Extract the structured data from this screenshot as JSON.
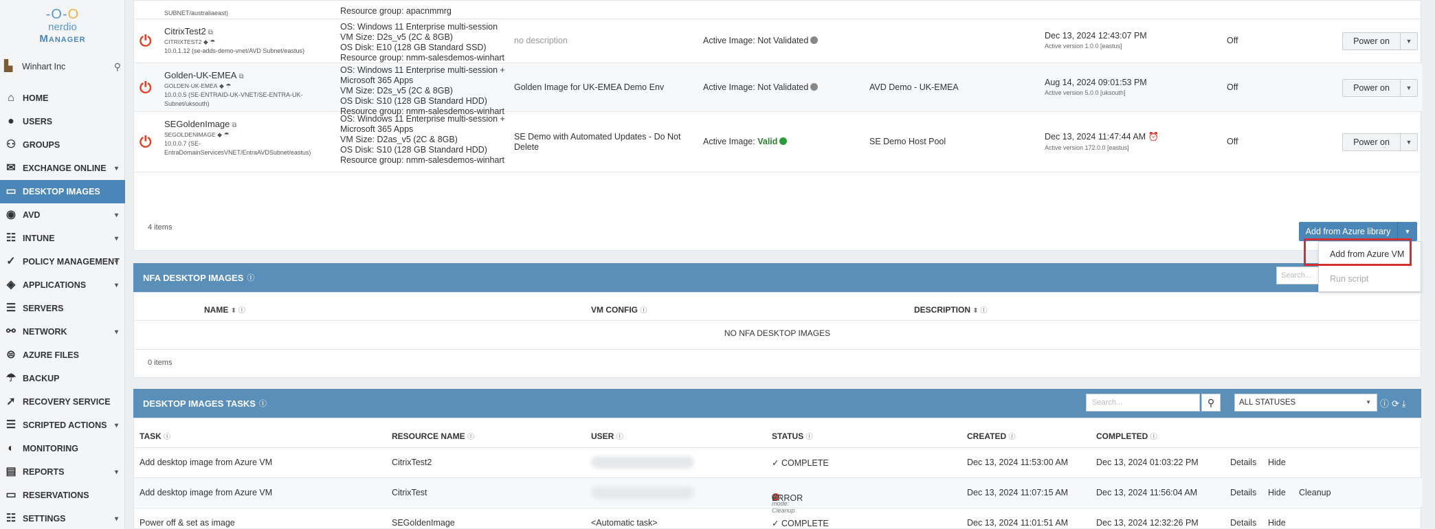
{
  "sidebar": {
    "logo_top": "nerdio",
    "logo_bottom": "Manager",
    "tenant": "Winhart Inc",
    "items": [
      {
        "label": "HOME",
        "icon": "home-icon",
        "glyph": "⌂",
        "chevron": false
      },
      {
        "label": "USERS",
        "icon": "user-icon",
        "glyph": "●",
        "chevron": false
      },
      {
        "label": "GROUPS",
        "icon": "groups-icon",
        "glyph": "⚇",
        "chevron": false
      },
      {
        "label": "EXCHANGE ONLINE",
        "icon": "mail-icon",
        "glyph": "✉",
        "chevron": true
      },
      {
        "label": "DESKTOP IMAGES",
        "icon": "desktop-icon",
        "glyph": "▭",
        "chevron": false,
        "active": true
      },
      {
        "label": "AVD",
        "icon": "avd-icon",
        "glyph": "◉",
        "chevron": true
      },
      {
        "label": "INTUNE",
        "icon": "intune-icon",
        "glyph": "☷",
        "chevron": true
      },
      {
        "label": "POLICY MANAGEMENT",
        "icon": "policy-icon",
        "glyph": "✓",
        "chevron": true
      },
      {
        "label": "APPLICATIONS",
        "icon": "apps-icon",
        "glyph": "◈",
        "chevron": true
      },
      {
        "label": "SERVERS",
        "icon": "servers-icon",
        "glyph": "☰",
        "chevron": false
      },
      {
        "label": "NETWORK",
        "icon": "network-icon",
        "glyph": "⚯",
        "chevron": true
      },
      {
        "label": "AZURE FILES",
        "icon": "files-icon",
        "glyph": "⊜",
        "chevron": false
      },
      {
        "label": "BACKUP",
        "icon": "backup-icon",
        "glyph": "☂",
        "chevron": false
      },
      {
        "label": "RECOVERY SERVICE",
        "icon": "recovery-icon",
        "glyph": "➚",
        "chevron": false
      },
      {
        "label": "SCRIPTED ACTIONS",
        "icon": "script-icon",
        "glyph": "☰",
        "chevron": true
      },
      {
        "label": "MONITORING",
        "icon": "monitoring-icon",
        "glyph": "◐",
        "chevron": false
      },
      {
        "label": "REPORTS",
        "icon": "reports-icon",
        "glyph": "▤",
        "chevron": true
      },
      {
        "label": "RESERVATIONS",
        "icon": "reservations-icon",
        "glyph": "▭",
        "chevron": false
      },
      {
        "label": "SETTINGS",
        "icon": "settings-icon",
        "glyph": "☷",
        "chevron": true
      }
    ]
  },
  "top_partial": {
    "sub": "SUBNET/australiaeast)",
    "config": "Resource group: apacnmmrg"
  },
  "images": [
    {
      "name": "CitrixTest2",
      "caption": "CITRIXTEST2",
      "network": "10.0.1.12 (se-adds-demo-vnet/AVD Subnet/eastus)",
      "config": [
        "OS: Windows 11 Enterprise multi-session",
        "VM Size: D2s_v5 (2C & 8GB)",
        "OS Disk: E10 (128 GB Standard SSD)",
        "Resource group: nmm-salesdemos-winhart"
      ],
      "description": "no description",
      "active_label": "Active Image:",
      "active_status": "Not Validated",
      "pool": "",
      "date": "Dec 13, 2024 12:43:07 PM",
      "version": "Active version 1.0.0 [eastus]",
      "state": "Off",
      "action": "Power on"
    },
    {
      "name": "Golden-UK-EMEA",
      "caption": "GOLDEN-UK-EMEA",
      "network": "10.0.0.5 (SE-ENTRAID-UK-VNET/SE-ENTRA-UK-Subnet/uksouth)",
      "config": [
        "OS: Windows 11 Enterprise multi-session +",
        "Microsoft 365 Apps",
        "VM Size: D2s_v5 (2C & 8GB)",
        "OS Disk: S10 (128 GB Standard HDD)",
        "Resource group: nmm-salesdemos-winhart"
      ],
      "description": "Golden Image for UK-EMEA Demo Env",
      "active_label": "Active Image:",
      "active_status": "Not Validated",
      "pool": "AVD Demo - UK-EMEA",
      "date": "Aug 14, 2024 09:01:53 PM",
      "version": "Active version 5.0.0 [uksouth]",
      "state": "Off",
      "action": "Power on"
    },
    {
      "name": "SEGoldenImage",
      "caption": "SEGOLDENIMAGE",
      "network": "10.0.0.7 (SE-EntraDomainServicesVNET/EntraAVDSubnet/eastus)",
      "config": [
        "OS: Windows 11 Enterprise multi-session +",
        "Microsoft 365 Apps",
        "VM Size: D2as_v5 (2C & 8GB)",
        "OS Disk: S10 (128 GB Standard HDD)",
        "Resource group: nmm-salesdemos-winhart"
      ],
      "description": "SE Demo with Automated Updates - Do Not Delete",
      "active_label": "Active Image:",
      "active_status": "Valid",
      "pool": "SE Demo Host Pool",
      "date": "Dec 13, 2024 11:47:44 AM",
      "version": "Active version 172.0.0 [eastus]",
      "state": "Off",
      "action": "Power on"
    }
  ],
  "items_count": "4 items",
  "add_button": "Add from Azure library",
  "dropdown": [
    "Add from Azure VM",
    "Run script"
  ],
  "nfa": {
    "title": "NFA DESKTOP IMAGES",
    "search_placeholder": "Search...",
    "columns": [
      "NAME",
      "VM CONFIG",
      "DESCRIPTION"
    ],
    "empty": "NO NFA DESKTOP IMAGES",
    "count": "0 items"
  },
  "tasks": {
    "title": "DESKTOP IMAGES TASKS",
    "search_placeholder": "Search...",
    "status_filter": "ALL STATUSES",
    "columns": [
      "TASK",
      "RESOURCE NAME",
      "USER",
      "STATUS",
      "CREATED",
      "COMPLETED"
    ],
    "rows": [
      {
        "task": "Add desktop image from Azure VM",
        "resource": "CitrixTest2",
        "user": "",
        "status": "✓ COMPLETE",
        "runmode": "",
        "created": "Dec 13, 2024 11:53:00 AM",
        "completed": "Dec 13, 2024 01:03:22 PM",
        "actions": [
          "Details",
          "Hide"
        ]
      },
      {
        "task": "Add desktop image from Azure VM",
        "resource": "CitrixTest",
        "user": "",
        "status": "ERROR",
        "runmode": "Run mode: Cleanup",
        "created": "Dec 13, 2024 11:07:15 AM",
        "completed": "Dec 13, 2024 11:56:04 AM",
        "actions": [
          "Details",
          "Hide",
          "Cleanup"
        ]
      },
      {
        "task": "Power off & set as image",
        "resource": "SEGoldenImage",
        "user": "<Automatic task>",
        "status": "✓ COMPLETE",
        "runmode": "",
        "created": "Dec 13, 2024 11:01:51 AM",
        "completed": "Dec 13, 2024 12:32:26 PM",
        "actions": [
          "Details",
          "Hide"
        ]
      }
    ]
  },
  "colors": {
    "accent": "#4a87b8",
    "section_header": "#5a8fb9",
    "power_icon": "#d9452b",
    "highlight": "#d32f2f"
  }
}
